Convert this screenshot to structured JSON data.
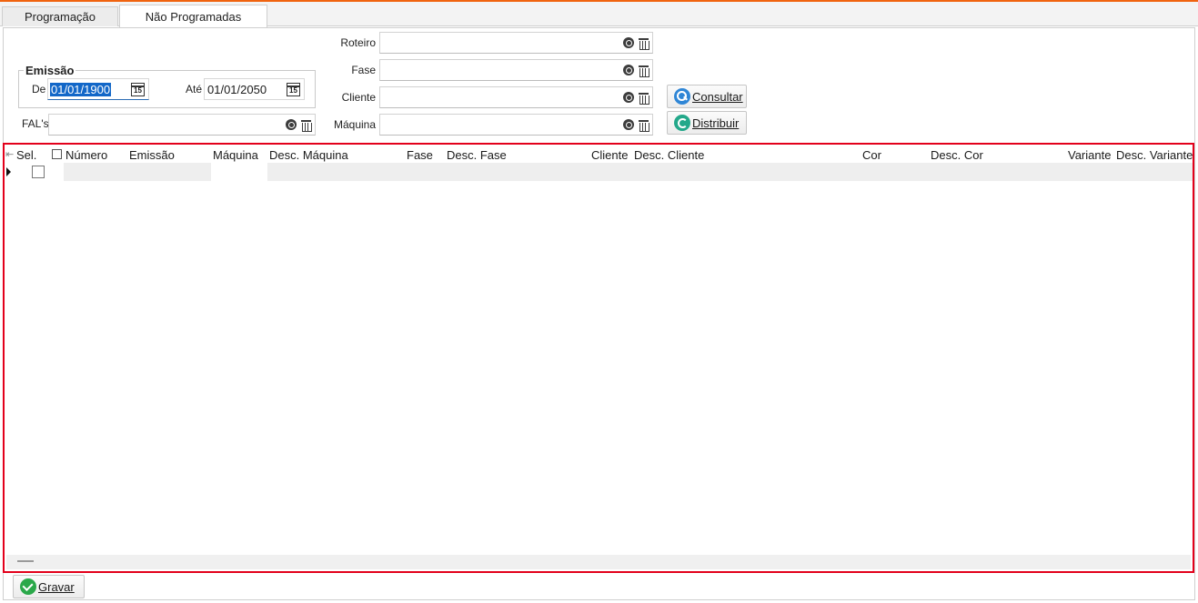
{
  "tabs": {
    "programacao": "Programação",
    "nao_programadas": "Não Programadas"
  },
  "emissao": {
    "title": "Emissão",
    "de_label": "De",
    "de_value": "01/01/1900",
    "ate_label": "Até",
    "ate_value": "01/01/2050",
    "calendar_glyph": "15"
  },
  "fals_label": "FAL's",
  "filters": {
    "roteiro": "Roteiro",
    "fase": "Fase",
    "cliente": "Cliente",
    "maquina": "Máquina"
  },
  "buttons": {
    "consultar": "Consultar",
    "distribuir": "Distribuir",
    "gravar": "Gravar"
  },
  "grid": {
    "columns": [
      "Sel.",
      "Número",
      "Emissão",
      "Máquina",
      "Desc. Máquina",
      "Fase",
      "Desc. Fase",
      "Cliente",
      "Desc. Cliente",
      "Cor",
      "Desc. Cor",
      "Variante",
      "Desc. Variante"
    ],
    "rows": []
  },
  "colors": {
    "accent_top": "#f0630f",
    "selection": "#1267c8",
    "grid_border": "#e3001b"
  },
  "icons": [
    "search-icon",
    "trash-icon",
    "calendar-icon",
    "refresh-icon",
    "check-icon"
  ]
}
